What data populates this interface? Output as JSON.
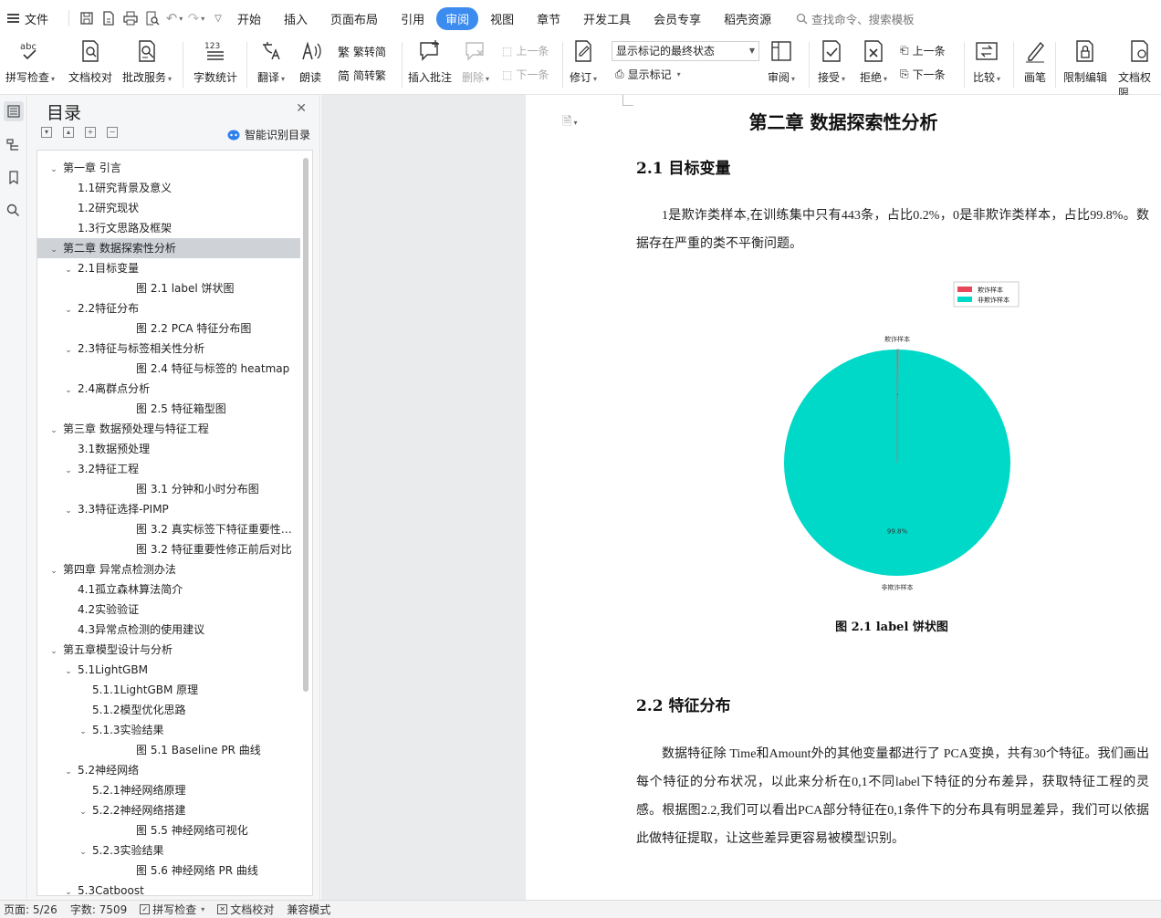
{
  "menubar": {
    "file_label": "文件",
    "tabs": [
      "开始",
      "插入",
      "页面布局",
      "引用",
      "审阅",
      "视图",
      "章节",
      "开发工具",
      "会员专享",
      "稻壳资源"
    ],
    "active_tab": "审阅",
    "search_placeholder": "查找命令、搜索模板"
  },
  "ribbon": {
    "spell_check": "拼写检查",
    "doc_proofread": "文档校对",
    "correction_service": "批改服务",
    "word_count": "字数统计",
    "translate": "翻译",
    "read_aloud": "朗读",
    "trad_to_simp": "繁转简",
    "simp_to_trad": "简转繁",
    "insert_comment": "插入批注",
    "delete": "删除",
    "prev_item": "上一条",
    "next_item": "下一条",
    "track_changes": "修订",
    "markup_mode": "显示标记的最终状态",
    "show_markup": "显示标记",
    "review": "审阅",
    "accept": "接受",
    "reject": "拒绝",
    "prev_change": "上一条",
    "next_change": "下一条",
    "compare": "比较",
    "pen": "画笔",
    "restrict_edit": "限制编辑",
    "doc_permission": "文档权限"
  },
  "toc": {
    "title": "目录",
    "smart_label": "智能识别目录",
    "items": [
      {
        "level": 1,
        "toggle": "v",
        "text": "第一章 引言"
      },
      {
        "level": 2,
        "toggle": "",
        "text": "1.1研究背景及意义"
      },
      {
        "level": 2,
        "toggle": "",
        "text": "1.2研究现状"
      },
      {
        "level": 2,
        "toggle": "",
        "text": "1.3行文思路及框架"
      },
      {
        "level": 1,
        "toggle": "v",
        "text": "第二章 数据探索性分析",
        "selected": true
      },
      {
        "level": 2,
        "toggle": "v",
        "text": "2.1目标变量"
      },
      {
        "level": 4,
        "toggle": "",
        "text": "图 2.1 label 饼状图"
      },
      {
        "level": 2,
        "toggle": "v",
        "text": "2.2特征分布"
      },
      {
        "level": 4,
        "toggle": "",
        "text": "图 2.2 PCA 特征分布图"
      },
      {
        "level": 2,
        "toggle": "v",
        "text": "2.3特征与标签相关性分析"
      },
      {
        "level": 4,
        "toggle": "",
        "text": "图 2.4 特征与标签的 heatmap"
      },
      {
        "level": 2,
        "toggle": "v",
        "text": "2.4离群点分析"
      },
      {
        "level": 4,
        "toggle": "",
        "text": "图 2.5 特征箱型图"
      },
      {
        "level": 1,
        "toggle": "v",
        "text": "第三章 数据预处理与特征工程"
      },
      {
        "level": 2,
        "toggle": "",
        "text": "3.1数据预处理"
      },
      {
        "level": 2,
        "toggle": "v",
        "text": "3.2特征工程"
      },
      {
        "level": 4,
        "toggle": "",
        "text": "图 3.1 分钟和小时分布图"
      },
      {
        "level": 2,
        "toggle": "v",
        "text": "3.3特征选择-PIMP"
      },
      {
        "level": 4,
        "toggle": "",
        "text": "图 3.2  真实标签下特征重要性分布"
      },
      {
        "level": 4,
        "toggle": "",
        "text": "图 3.2 特征重要性修正前后对比"
      },
      {
        "level": 1,
        "toggle": "v",
        "text": "第四章 异常点检测办法"
      },
      {
        "level": 2,
        "toggle": "",
        "text": "4.1孤立森林算法简介"
      },
      {
        "level": 2,
        "toggle": "",
        "text": "4.2实验验证"
      },
      {
        "level": 2,
        "toggle": "",
        "text": "4.3异常点检测的使用建议"
      },
      {
        "level": 1,
        "toggle": "v",
        "text": "第五章模型设计与分析"
      },
      {
        "level": 2,
        "toggle": "v",
        "text": "5.1LightGBM"
      },
      {
        "level": 3,
        "toggle": "",
        "text": "5.1.1LightGBM 原理"
      },
      {
        "level": 3,
        "toggle": "",
        "text": "5.1.2模型优化思路"
      },
      {
        "level": 3,
        "toggle": "v",
        "text": "5.1.3实验结果"
      },
      {
        "level": 4,
        "toggle": "",
        "text": "图 5.1 Baseline PR 曲线"
      },
      {
        "level": 2,
        "toggle": "v",
        "text": "5.2神经网络"
      },
      {
        "level": 3,
        "toggle": "",
        "text": "5.2.1神经网络原理"
      },
      {
        "level": 3,
        "toggle": "v",
        "text": "5.2.2神经网络搭建"
      },
      {
        "level": 4,
        "toggle": "",
        "text": "图 5.5 神经网络可视化"
      },
      {
        "level": 3,
        "toggle": "v",
        "text": "5.2.3实验结果"
      },
      {
        "level": 4,
        "toggle": "",
        "text": "图 5.6  神经网络 PR 曲线"
      },
      {
        "level": 2,
        "toggle": "v",
        "text": "5.3Catboost"
      }
    ]
  },
  "doc": {
    "chapter_title": "第二章 数据探索性分析",
    "sec21_title": "2.1 目标变量",
    "sec21_para": "1是欺诈类样本,在训练集中只有443条，占比0.2%，0是非欺诈类样本，占比99.8%。数据存在严重的类不平衡问题。",
    "figure_caption": "图 2.1 label 饼状图",
    "sec22_title": "2.2 特征分布",
    "sec22_para": "数据特征除 Time和Amount外的其他变量都进行了 PCA变换，共有30个特征。我们画出每个特征的分布状况，以此来分析在0,1不同label下特征的分布差异，获取特征工程的灵感。根据图2.2,我们可以看出PCA部分特征在0,1条件下的分布具有明显差异，我们可以依据此做特征提取，让这些差异更容易被模型识别。"
  },
  "chart_data": {
    "type": "pie",
    "categories": [
      "欺诈样本",
      "非欺诈样本"
    ],
    "values": [
      0.2,
      99.8
    ],
    "pct_labels": [
      "0.2%",
      "99.8%"
    ],
    "colors": [
      "#e8475a",
      "#00d8c8"
    ],
    "legend_position": "top-right"
  },
  "status": {
    "page": "页面: 5/26",
    "words": "字数: 7509",
    "spell_check": "拼写检查",
    "doc_proofread": "文档校对",
    "compat_mode": "兼容模式"
  }
}
